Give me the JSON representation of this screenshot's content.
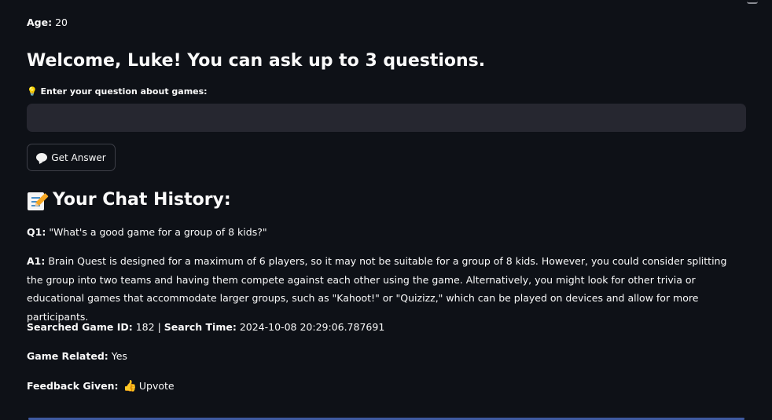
{
  "profile": {
    "age_label": "Age:",
    "age_value": "20"
  },
  "welcome": {
    "heading": "Welcome, Luke! You can ask up to 3 questions."
  },
  "question_form": {
    "label_icon": "💡",
    "label": "Enter your question about games:",
    "input_value": "",
    "input_placeholder": "",
    "button_icon": "speech-bubble-icon",
    "button_label": "Get Answer"
  },
  "history": {
    "title_icon": "memo-icon",
    "title": "Your Chat History:",
    "entries": [
      {
        "q_label": "Q1:",
        "question": "\"What's a good game for a group of 8 kids?\"",
        "a_label": "A1:",
        "answer": "Brain Quest is designed for a maximum of 6 players, so it may not be suitable for a group of 8 kids. However, you could consider splitting the group into two teams and having them compete against each other using the game. Alternatively, you might look for other trivia or educational games that accommodate larger groups, such as \"Kahoot!\" or \"Quizizz,\" which can be played on devices and allow for more participants.",
        "game_id_label": "Searched Game ID:",
        "game_id": "182",
        "separator": "|",
        "search_time_label": "Search Time:",
        "search_time": "2024-10-08 20:29:06.787691",
        "related_label": "Game Related:",
        "related": "Yes",
        "feedback_label": "Feedback Given:",
        "feedback_icon": "👍",
        "feedback": "Upvote"
      }
    ]
  },
  "colors": {
    "background": "#0e1117",
    "text": "#fafafa",
    "input_bg": "#262730",
    "button_border": "#3d3f48",
    "divider": "#3f5aa0"
  }
}
